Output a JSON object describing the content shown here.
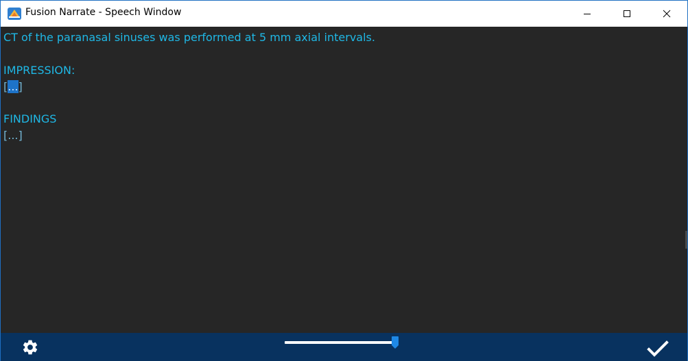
{
  "window": {
    "title": "Fusion Narrate - Speech Window"
  },
  "document": {
    "line1": "CT of the paranasal sinuses was performed at 5 mm axial intervals.",
    "impression_header": "IMPRESSION:",
    "impression_open": "[",
    "impression_selected": "...",
    "impression_close": "]",
    "findings_header": "FINDINGS",
    "findings_placeholder": "[...]"
  },
  "toolbar": {
    "settings_icon": "gear-icon",
    "accept_icon": "checkmark-icon",
    "volume_level": 0.97
  },
  "colors": {
    "editor_background": "#262626",
    "text_cyan": "#1fb8e6",
    "bottom_bar": "#08325f",
    "selection": "#1e73c8",
    "slider_thumb": "#1e88e5"
  }
}
